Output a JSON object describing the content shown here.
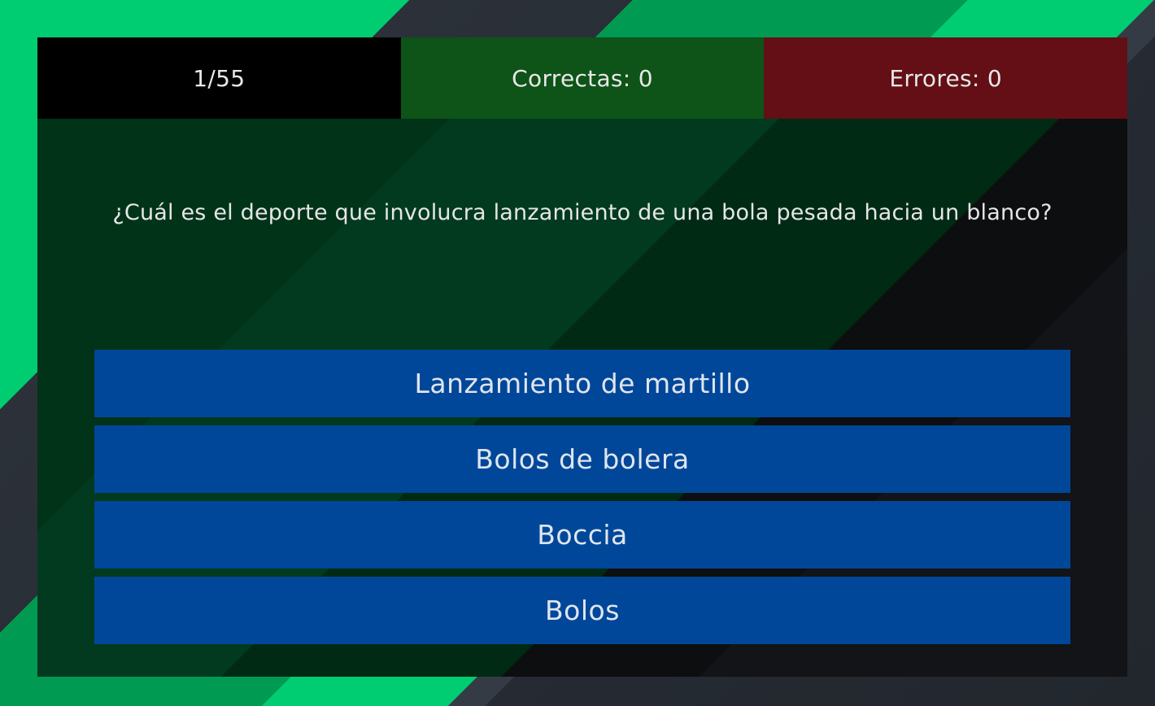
{
  "stats": {
    "progress": "1/55",
    "correct": "Correctas: 0",
    "errors": "Errores: 0"
  },
  "question": "¿Cuál es el deporte que involucra lanzamiento de una bola pesada hacia un blanco?",
  "answers": [
    {
      "label": "Lanzamiento de martillo"
    },
    {
      "label": "Bolos de bolera"
    },
    {
      "label": "Boccia"
    },
    {
      "label": "Bolos"
    }
  ],
  "colors": {
    "progress_bg": "#000000",
    "correct_bg": "#0e5318",
    "errors_bg": "#630f15",
    "answer_bg": "#00479a",
    "accent_green": "#00cc72"
  }
}
